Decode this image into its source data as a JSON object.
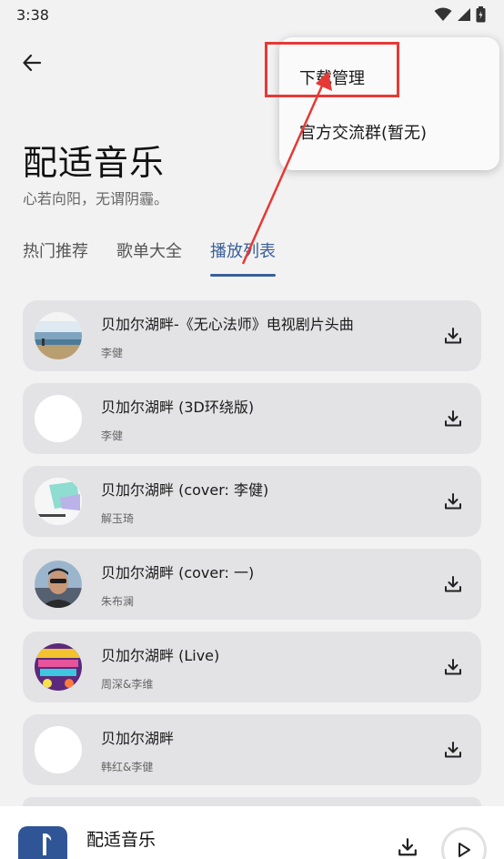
{
  "status_bar": {
    "time": "3:38"
  },
  "page": {
    "title": "配适音乐",
    "subtitle": "心若向阳，无谓阴霾。"
  },
  "tabs": [
    {
      "label": "热门推荐",
      "active": false
    },
    {
      "label": "歌单大全",
      "active": false
    },
    {
      "label": "播放列表",
      "active": true
    }
  ],
  "songs": [
    {
      "title": "贝加尔湖畔-《无心法师》电视剧片头曲",
      "artist": "李健",
      "cover": "landscape-cover"
    },
    {
      "title": "贝加尔湖畔 (3D环绕版)",
      "artist": "李健",
      "cover": "blank-cover"
    },
    {
      "title": "贝加尔湖畔 (cover: 李健)",
      "artist": "解玉琦",
      "cover": "teal-block-cover"
    },
    {
      "title": "贝加尔湖畔 (cover: 一)",
      "artist": "朱布澜",
      "cover": "portrait-cover"
    },
    {
      "title": "贝加尔湖畔 (Live)",
      "artist": "周深&李维",
      "cover": "purple-event-cover"
    },
    {
      "title": "贝加尔湖畔",
      "artist": "韩红&李健",
      "cover": "blank-cover"
    }
  ],
  "menu": {
    "items": [
      {
        "label": "下载管理"
      },
      {
        "label": "官方交流群(暂无)"
      }
    ]
  },
  "player": {
    "title": "配适音乐"
  },
  "colors": {
    "accent": "#3a5f9a",
    "annotation": "#e53935",
    "card": "#e3e3e5"
  }
}
